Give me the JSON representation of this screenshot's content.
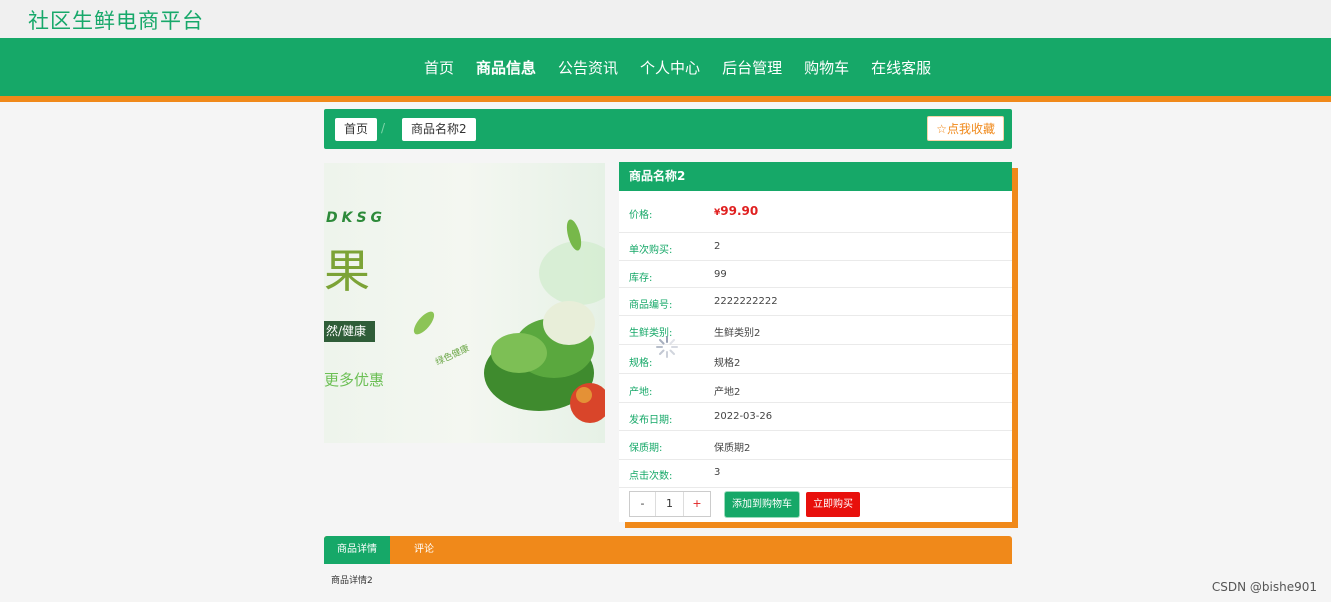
{
  "site": {
    "title": "社区生鲜电商平台"
  },
  "nav": {
    "items": [
      "首页",
      "商品信息",
      "公告资讯",
      "个人中心",
      "后台管理",
      "购物车",
      "在线客服"
    ],
    "active_index": 1
  },
  "breadcrumb": {
    "home": "首页",
    "separator": "/",
    "current": "商品名称2"
  },
  "favorite": {
    "label": "☆点我收藏"
  },
  "banner": {
    "line1": "DKSG",
    "line2": "果",
    "line3": "然/健康",
    "line4": "更多优惠",
    "line5": "绿色健康"
  },
  "product": {
    "name": "商品名称2",
    "price_label": "价格:",
    "price_symbol": "¥",
    "price_value": "99.90",
    "fields": [
      {
        "label": "单次购买:",
        "value": "2"
      },
      {
        "label": "库存:",
        "value": "99"
      },
      {
        "label": "商品编号:",
        "value": "2222222222"
      },
      {
        "label": "生鲜类别:",
        "value": "生鲜类别2"
      },
      {
        "label": "规格:",
        "value": "规格2"
      },
      {
        "label": "产地:",
        "value": "产地2"
      },
      {
        "label": "发布日期:",
        "value": "2022-03-26"
      },
      {
        "label": "保质期:",
        "value": "保质期2"
      },
      {
        "label": "点击次数:",
        "value": "3"
      }
    ]
  },
  "quantity": {
    "minus": "-",
    "value": "1",
    "plus": "+"
  },
  "actions": {
    "add_to_cart": "添加到购物车",
    "buy_now": "立即购买"
  },
  "tabs": {
    "items": [
      "商品详情",
      "评论"
    ],
    "active_index": 0
  },
  "detail": {
    "text": "商品详情2"
  },
  "watermark": "CSDN @bishe901",
  "colors": {
    "primary": "#16a868",
    "accent": "#f0891a",
    "danger": "#e8100c"
  },
  "icons": {
    "loading": "spinner-icon",
    "favorite": "star-icon"
  }
}
